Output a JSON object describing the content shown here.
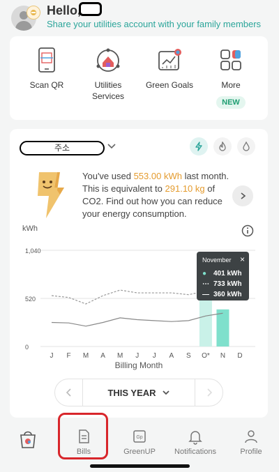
{
  "header": {
    "greeting": "Hello,",
    "subtitle": "Share your utilities account with your family members"
  },
  "quick_actions": [
    {
      "label": "Scan QR",
      "icon": "scan-qr-icon"
    },
    {
      "label": "Utilities\nServices",
      "icon": "utilities-services-icon"
    },
    {
      "label": "Green Goals",
      "icon": "green-goals-icon"
    },
    {
      "label": "More",
      "icon": "more-grid-icon",
      "badge": "NEW"
    }
  ],
  "address": {
    "label": "주소"
  },
  "energy_types": [
    {
      "name": "electricity-icon",
      "active": true
    },
    {
      "name": "gas-icon",
      "active": false
    },
    {
      "name": "water-icon",
      "active": false
    }
  ],
  "info": {
    "line1_prefix": "You've used ",
    "usage": "553.00 kWh",
    "line1_suffix": " last month.",
    "line2_prefix": "This is equivalent to ",
    "co2": "291.10 kg",
    "line2_suffix": " of CO2.",
    "line3": "Find out how you can reduce your energy consumption."
  },
  "chart_data": {
    "type": "bar",
    "ylabel": "kWh",
    "xlabel": "Billing Month",
    "yticks": [
      "0",
      "520",
      "1,040"
    ],
    "ylim": [
      0,
      1040
    ],
    "categories": [
      "J",
      "F",
      "M",
      "A",
      "M",
      "J",
      "J",
      "A",
      "S",
      "O*",
      "N",
      "D"
    ],
    "series": [
      {
        "style": "bar",
        "values": [
          null,
          null,
          null,
          null,
          null,
          null,
          null,
          null,
          null,
          553,
          401,
          null
        ],
        "color": "#7fe0cc"
      },
      {
        "style": "dashed-line",
        "values": [
          550,
          530,
          460,
          550,
          610,
          580,
          580,
          580,
          560,
          600,
          733,
          null
        ],
        "color": "#999999"
      },
      {
        "style": "solid-line",
        "values": [
          260,
          255,
          220,
          260,
          310,
          290,
          280,
          270,
          280,
          330,
          360,
          null
        ],
        "color": "#888888"
      }
    ],
    "tooltip": {
      "title": "November",
      "rows": [
        {
          "label": "401 kWh",
          "marker": "dot",
          "color": "#7fe0cc"
        },
        {
          "label": "733 kWh",
          "marker": "dash",
          "color": "#ffffff"
        },
        {
          "label": "360 kWh",
          "marker": "line",
          "color": "#ffffff"
        }
      ],
      "close": "×"
    }
  },
  "year_selector": {
    "label": "THIS YEAR"
  },
  "nav": [
    {
      "label": "",
      "icon": "shop-bag-icon"
    },
    {
      "label": "Bills",
      "icon": "bills-icon"
    },
    {
      "label": "GreenUP",
      "icon": "greenup-icon"
    },
    {
      "label": "Notifications",
      "icon": "bell-icon"
    },
    {
      "label": "Profile",
      "icon": "profile-icon"
    }
  ]
}
